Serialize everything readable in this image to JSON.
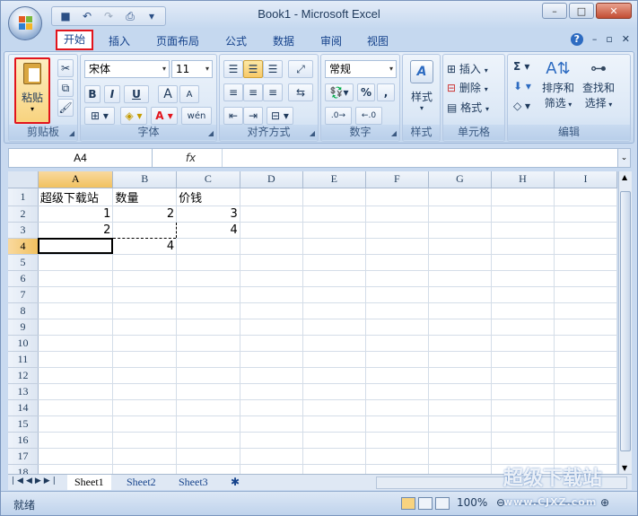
{
  "window": {
    "title": "Book1 - Microsoft Excel",
    "min": "–",
    "max": "□",
    "close": "✕"
  },
  "qat": {
    "items": [
      "save-icon",
      "undo-icon",
      "redo-icon",
      "print-preview-icon"
    ],
    "more": "▾"
  },
  "tabs": [
    "开始",
    "插入",
    "页面布局",
    "公式",
    "数据",
    "审阅",
    "视图"
  ],
  "active_tab": "开始",
  "tab_icons": {
    "help": "?",
    "minimize": "–",
    "restore": "▫",
    "close": "✕"
  },
  "ribbon": {
    "clipboard": {
      "label": "剪贴板",
      "paste": "粘贴"
    },
    "font": {
      "label": "字体",
      "name": "宋体",
      "size": "11",
      "grow": "A",
      "shrink": "A",
      "bold": "B",
      "italic": "I",
      "underline": "U",
      "phonetic": "wén"
    },
    "alignment": {
      "label": "对齐方式"
    },
    "number": {
      "label": "数字",
      "format": "常规",
      "percent": "%",
      "comma": ","
    },
    "styles": {
      "label": "样式",
      "button": "样式"
    },
    "cells": {
      "label": "单元格",
      "insert": "插入",
      "delete": "删除",
      "format": "格式"
    },
    "editing": {
      "label": "编辑",
      "sort": "排序和",
      "sort2": "筛选",
      "find": "查找和",
      "find2": "选择"
    }
  },
  "formula_bar": {
    "name_box": "A4",
    "fx": "fx",
    "formula": ""
  },
  "columns": [
    "A",
    "B",
    "C",
    "D",
    "E",
    "F",
    "G",
    "H",
    "I"
  ],
  "rows": [
    [
      "超级下载站",
      "数量",
      "价钱",
      "",
      "",
      "",
      "",
      "",
      ""
    ],
    [
      "1",
      "2",
      "3",
      "",
      "",
      "",
      "",
      "",
      ""
    ],
    [
      "2",
      "",
      "4",
      "",
      "",
      "",
      "",
      "",
      ""
    ],
    [
      "",
      "4",
      "",
      "",
      "",
      "",
      "",
      "",
      ""
    ],
    [
      "",
      "",
      "",
      "",
      "",
      "",
      "",
      "",
      ""
    ],
    [
      "",
      "",
      "",
      "",
      "",
      "",
      "",
      "",
      ""
    ],
    [
      "",
      "",
      "",
      "",
      "",
      "",
      "",
      "",
      ""
    ],
    [
      "",
      "",
      "",
      "",
      "",
      "",
      "",
      "",
      ""
    ],
    [
      "",
      "",
      "",
      "",
      "",
      "",
      "",
      "",
      ""
    ],
    [
      "",
      "",
      "",
      "",
      "",
      "",
      "",
      "",
      ""
    ],
    [
      "",
      "",
      "",
      "",
      "",
      "",
      "",
      "",
      ""
    ],
    [
      "",
      "",
      "",
      "",
      "",
      "",
      "",
      "",
      ""
    ],
    [
      "",
      "",
      "",
      "",
      "",
      "",
      "",
      "",
      ""
    ],
    [
      "",
      "",
      "",
      "",
      "",
      "",
      "",
      "",
      ""
    ],
    [
      "",
      "",
      "",
      "",
      "",
      "",
      "",
      "",
      ""
    ],
    [
      "",
      "",
      "",
      "",
      "",
      "",
      "",
      "",
      ""
    ],
    [
      "",
      "",
      "",
      "",
      "",
      "",
      "",
      "",
      ""
    ],
    [
      "",
      "",
      "",
      "",
      "",
      "",
      "",
      "",
      ""
    ]
  ],
  "active_cell": "A4",
  "sheets": [
    "Sheet1",
    "Sheet2",
    "Sheet3"
  ],
  "active_sheet": "Sheet1",
  "status": {
    "ready": "就绪",
    "zoom": "100%"
  },
  "watermark": {
    "text": "超级下载站",
    "url": "www.CJXZ.com"
  },
  "colors": {
    "accent": "#15428b",
    "highlight": "#e2141c",
    "selection": "#f1c15f"
  }
}
